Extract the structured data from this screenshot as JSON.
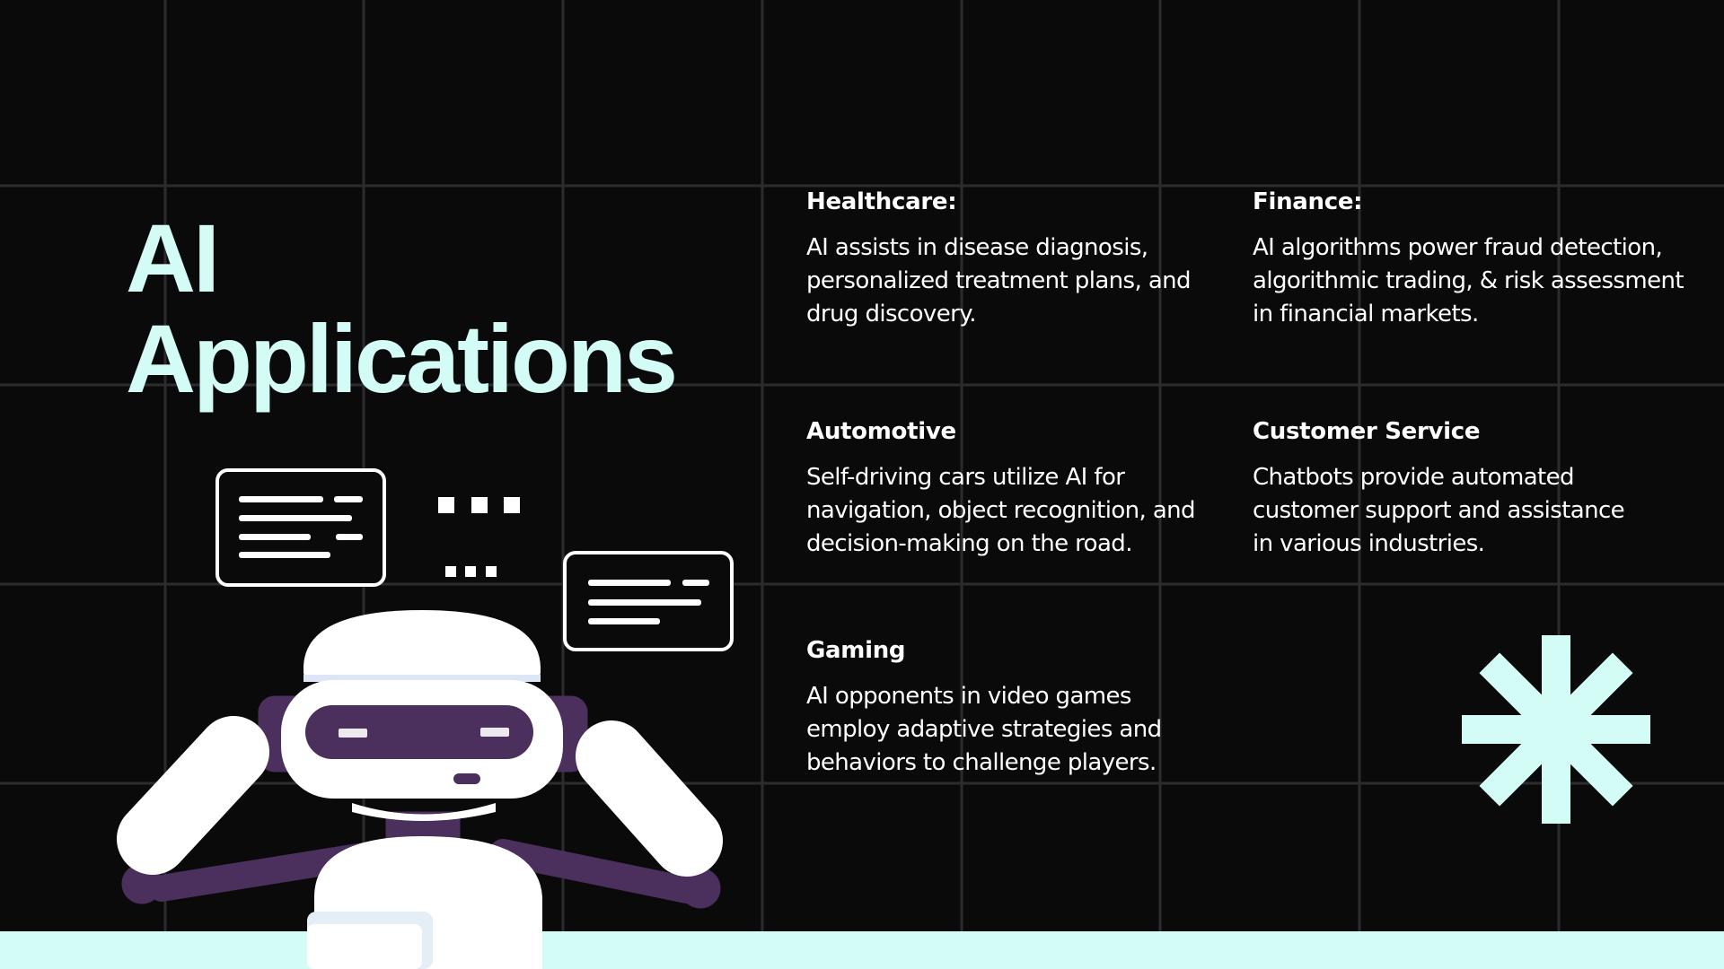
{
  "title_lines": [
    "AI",
    "Applications"
  ],
  "applications": [
    {
      "heading": "Healthcare:",
      "text": "AI assists in disease diagnosis, personalized treatment plans, and drug discovery."
    },
    {
      "heading": "Finance:",
      "text": "AI algorithms power fraud detection, algorithmic trading, & risk assessment in financial markets."
    },
    {
      "heading": "Automotive",
      "text": "Self-driving cars utilize AI for navigation, object recognition, and decision-making on the road."
    },
    {
      "heading": "Customer Service",
      "text": "Chatbots provide automated customer support and assistance in various industries."
    },
    {
      "heading": "Gaming",
      "text": "AI opponents in video games employ adaptive strategies and behaviors to challenge players."
    }
  ],
  "colors": {
    "background": "#0a0a0b",
    "grid_line": "#2c2c2f",
    "accent_mint": "#d4fcf6",
    "robot_purple": "#4b2f5c",
    "robot_white": "#ffffff",
    "text": "#ffffff"
  },
  "icons": {
    "decoration": "asterisk-icon",
    "illustration": "robot-illustration"
  }
}
